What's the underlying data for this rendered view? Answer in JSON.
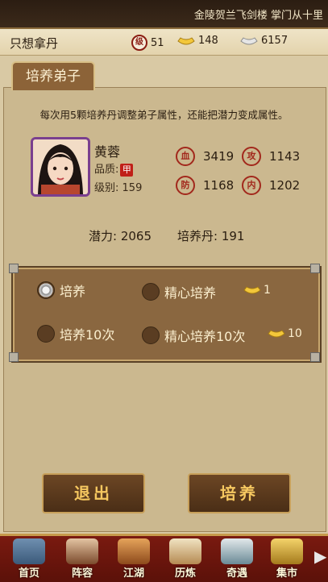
{
  "marquee": {
    "text": "金陵贺兰飞剑楼 掌门从十里"
  },
  "status": {
    "player_name": "只想拿丹",
    "level_icon": "级",
    "level": "51",
    "gold": "148",
    "silver": "6157"
  },
  "tab": {
    "label": "培养弟子"
  },
  "description": "每次用5颗培养丹调整弟子属性，还能把潜力变成属性。",
  "hero": {
    "name": "黄蓉",
    "quality_label": "品质:",
    "quality_badge": "甲",
    "level_label": "级别:",
    "level": "159",
    "attrs": [
      {
        "icon": "血",
        "value": "3419"
      },
      {
        "icon": "攻",
        "value": "1143"
      },
      {
        "icon": "防",
        "value": "1168"
      },
      {
        "icon": "内",
        "value": "1202"
      }
    ]
  },
  "potential": {
    "label": "潜力:",
    "value": "2065",
    "pill_label": "培养丹:",
    "pill_value": "191"
  },
  "options": [
    {
      "label": "培养",
      "selected": true
    },
    {
      "label": "精心培养",
      "selected": false,
      "cost": "1"
    },
    {
      "label": "培养10次",
      "selected": false
    },
    {
      "label": "精心培养10次",
      "selected": false,
      "cost": "10"
    }
  ],
  "buttons": {
    "exit": "退出",
    "train": "培养"
  },
  "nav": [
    {
      "label": "首页",
      "icon": "home-icon"
    },
    {
      "label": "阵容",
      "icon": "lineup-icon"
    },
    {
      "label": "江湖",
      "icon": "jianghu-icon"
    },
    {
      "label": "历炼",
      "icon": "training-icon"
    },
    {
      "label": "奇遇",
      "icon": "adventure-icon"
    },
    {
      "label": "集市",
      "icon": "market-icon"
    }
  ],
  "colors": {
    "accent": "#8c6338",
    "nav_bg": "#7a1a10",
    "button_text": "#f6c860"
  }
}
